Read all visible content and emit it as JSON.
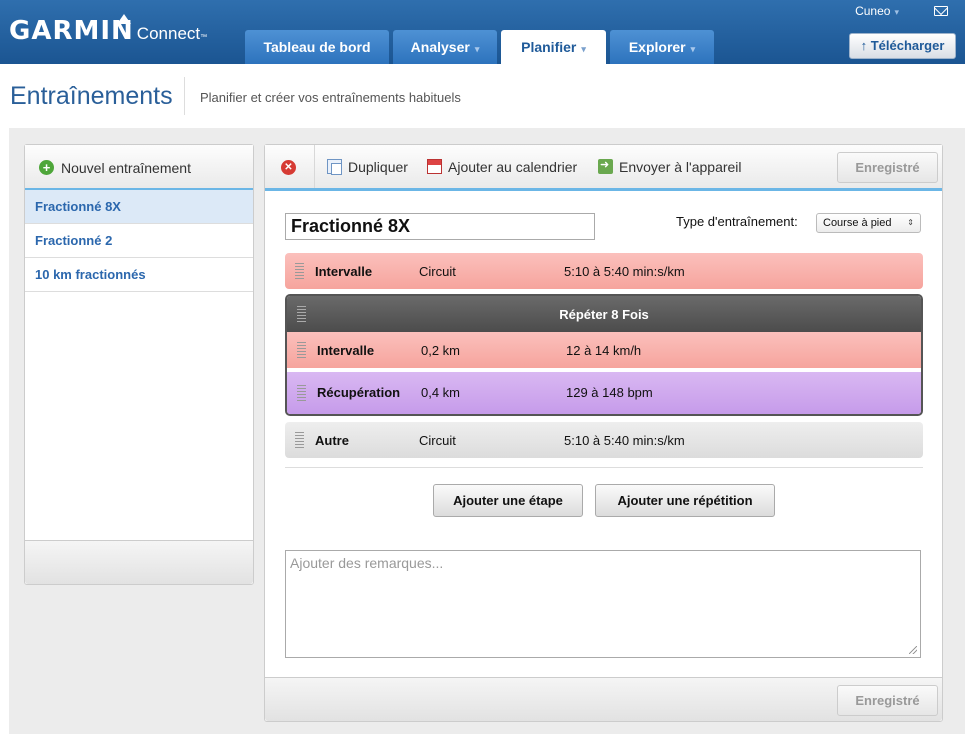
{
  "header": {
    "brand_garmin": "GARMIN",
    "brand_connect": "Connect",
    "brand_tm": "™",
    "user_name": "Cuneo",
    "upload_label": "Télécharger",
    "upload_arrow": "↑",
    "tabs": [
      {
        "label": "Tableau de bord",
        "has_caret": false,
        "active": false
      },
      {
        "label": "Analyser",
        "has_caret": true,
        "active": false
      },
      {
        "label": "Planifier",
        "has_caret": true,
        "active": true
      },
      {
        "label": "Explorer",
        "has_caret": true,
        "active": false
      }
    ],
    "caret": "▾",
    "icons": {
      "mail": "mail-icon"
    }
  },
  "page": {
    "title": "Entraînements",
    "subtitle": "Planifier et créer vos entraînements habituels"
  },
  "sidebar": {
    "new_label": "Nouvel entraînement",
    "new_icon_glyph": "+",
    "items": [
      {
        "label": "Fractionné 8X",
        "selected": true
      },
      {
        "label": "Fractionné 2",
        "selected": false
      },
      {
        "label": "10 km fractionnés",
        "selected": false
      }
    ]
  },
  "toolbar": {
    "delete_glyph": "✕",
    "duplicate_label": "Dupliquer",
    "calendar_label": "Ajouter au calendrier",
    "send_label": "Envoyer à l'appareil",
    "saved_label": "Enregistré"
  },
  "workout": {
    "name": "Fractionné 8X",
    "type_label": "Type d'entraînement:",
    "type_value": "Course à pied",
    "type_arrows": "⇕",
    "steps": {
      "first": {
        "type": "Intervalle",
        "duration": "Circuit",
        "target": "5:10 à 5:40 min:s/km"
      },
      "repeat_title": "Répéter 8 Fois",
      "repeat_steps": [
        {
          "type": "Intervalle",
          "duration": "0,2 km",
          "target": "12 à 14 km/h"
        },
        {
          "type": "Récupération",
          "duration": "0,4 km",
          "target": "129 à 148 bpm"
        }
      ],
      "last": {
        "type": "Autre",
        "duration": "Circuit",
        "target": "5:10 à 5:40 min:s/km"
      }
    },
    "add_step_label": "Ajouter une étape",
    "add_repeat_label": "Ajouter une répétition",
    "notes_placeholder": "Ajouter des remarques...",
    "footer_saved_label": "Enregistré"
  },
  "colors": {
    "brand_blue": "#1b5592",
    "interval": "#f6a49d",
    "recovery": "#c69bea",
    "other": "#dcdcdc",
    "repeat_header": "#555555"
  }
}
